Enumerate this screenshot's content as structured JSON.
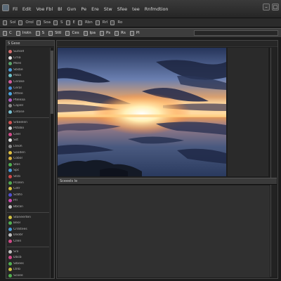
{
  "app": {
    "menu": [
      "Fil",
      "Edit",
      "Voe Fbl",
      "Bl",
      "Gvn",
      "Pe",
      "Ere",
      "Stw",
      "Sfee",
      "tee",
      "Rnfmdtion"
    ]
  },
  "toolbar": {
    "items": [
      "Sol",
      "Orol",
      "Soa",
      "S",
      "E",
      "Rbn",
      "Rrl",
      "Ro"
    ]
  },
  "panel_header": {
    "items": [
      "C",
      "Irotn",
      "S",
      "Sttl",
      "Ces",
      "Ipa",
      "Ps",
      "Rs",
      "Pl"
    ]
  },
  "left_panel": {
    "tab": "S Gese",
    "groups": [
      {
        "items": [
          {
            "label": "Sunset",
            "color": "#d36a6a"
          },
          {
            "label": "Crna",
            "color": "#e0e0e0"
          },
          {
            "label": "Mses",
            "color": "#5aa36a"
          },
          {
            "label": "Sbsbe",
            "color": "#4c9ad8"
          },
          {
            "label": "Poba",
            "color": "#6fc2c9"
          },
          {
            "label": "Ceroke",
            "color": "#d05a9a"
          },
          {
            "label": "Cerar",
            "color": "#4a8fd8"
          },
          {
            "label": "Uttlee",
            "color": "#4aa6e0"
          },
          {
            "label": "Pteleaa",
            "color": "#b05ac0"
          },
          {
            "label": "Caplel",
            "color": "#8a8a8a"
          },
          {
            "label": "Cetose",
            "color": "#78c0d0"
          }
        ]
      },
      {
        "items": [
          {
            "label": "Srbeelen",
            "color": "#d05050"
          },
          {
            "label": "Pstobo",
            "color": "#cfcfcf"
          },
          {
            "label": "Ceel",
            "color": "#d04a88"
          },
          {
            "label": "Sst",
            "color": "#e0e0e0"
          },
          {
            "label": "Lteoh",
            "color": "#8a8a8a"
          },
          {
            "label": "Sooden",
            "color": "#e0c040"
          },
          {
            "label": "Cobor",
            "color": "#d8b040"
          },
          {
            "label": "Stos",
            "color": "#50b050"
          },
          {
            "label": "Spc",
            "color": "#4a9ad8"
          },
          {
            "label": "Stcb",
            "color": "#d04a4a"
          },
          {
            "label": "Pcolen",
            "color": "#50a850"
          },
          {
            "label": "Cetr",
            "color": "#d8c040"
          },
          {
            "label": "Scbto",
            "color": "#5050d0"
          },
          {
            "label": "Prl",
            "color": "#d04ab0"
          },
          {
            "label": "Bbcan",
            "color": "#c0c0c0"
          }
        ]
      },
      {
        "items": [
          {
            "label": "Stoneerten",
            "color": "#d0c040"
          },
          {
            "label": "Beor",
            "color": "#50b050"
          },
          {
            "label": "Crdstees",
            "color": "#4a9ad8"
          },
          {
            "label": "Doobr",
            "color": "#c0c0c0"
          },
          {
            "label": "Cllen",
            "color": "#d04a88"
          }
        ]
      },
      {
        "items": [
          {
            "label": "Sra",
            "color": "#c0c0c0"
          },
          {
            "label": "Dbcb",
            "color": "#d04a88"
          },
          {
            "label": "Slbees",
            "color": "#50b050"
          },
          {
            "label": "Ltnb",
            "color": "#d0c040"
          },
          {
            "label": "Scoee",
            "color": "#50b050"
          }
        ]
      }
    ]
  },
  "canvas": {
    "lower_strip_label": "Sceeels le"
  },
  "colors": {
    "sky_top": "#2c3a58",
    "sky_mid": "#7a8ab0",
    "sun": "#fff2c0",
    "horizon_orange": "#f08a3a",
    "water": "#2e3e62"
  }
}
